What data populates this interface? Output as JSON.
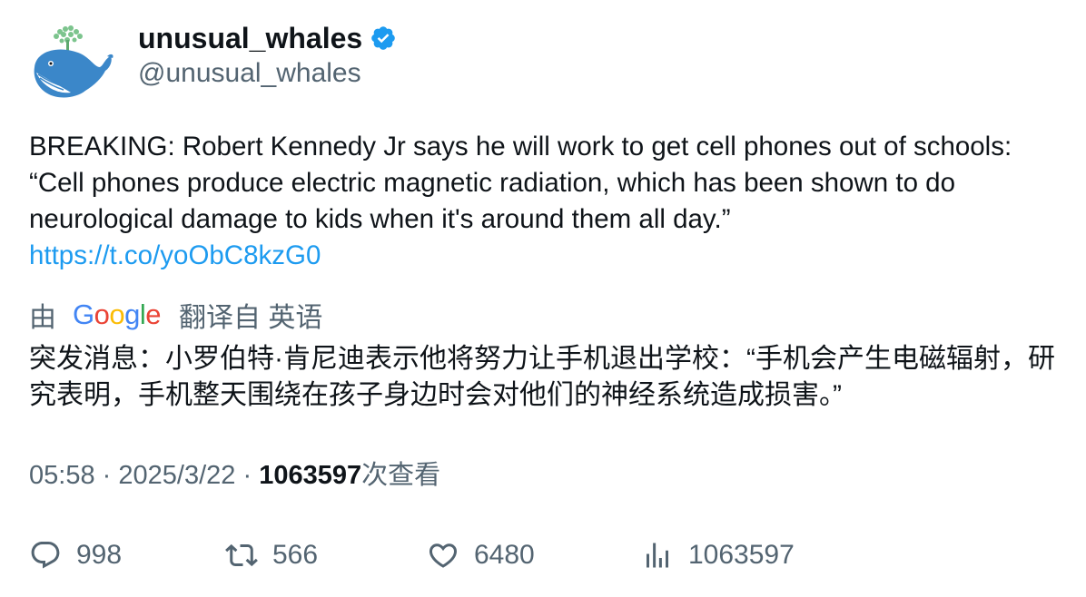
{
  "author": {
    "display_name": "unusual_whales",
    "handle": "@unusual_whales",
    "avatar_icon": "whale-icon",
    "verified_icon": "verified-badge-icon",
    "verified_color": "#1d9bf0"
  },
  "tweet": {
    "text": "BREAKING: Robert Kennedy Jr says he will work to get cell phones out of schools: “Cell phones produce electric magnetic radiation, which has been shown to do neurological damage to kids when it's around them all day.”",
    "link": "https://t.co/yoObC8kzG0",
    "link_color": "#1d9bf0"
  },
  "translation": {
    "prefix": "由",
    "provider": "Google",
    "suffix": "翻译自 英语",
    "text": "突发消息：小罗伯特·肯尼迪表示他将努力让手机退出学校：“手机会产生电磁辐射，研究表明，手机整天围绕在孩子身边时会对他们的神经系统造成损害。”"
  },
  "meta": {
    "time": "05:58",
    "separator": "·",
    "date": "2025/3/22",
    "views": "1063597",
    "views_label": "次查看"
  },
  "actions": {
    "replies": "998",
    "retweets": "566",
    "likes": "6480",
    "views": "1063597"
  }
}
